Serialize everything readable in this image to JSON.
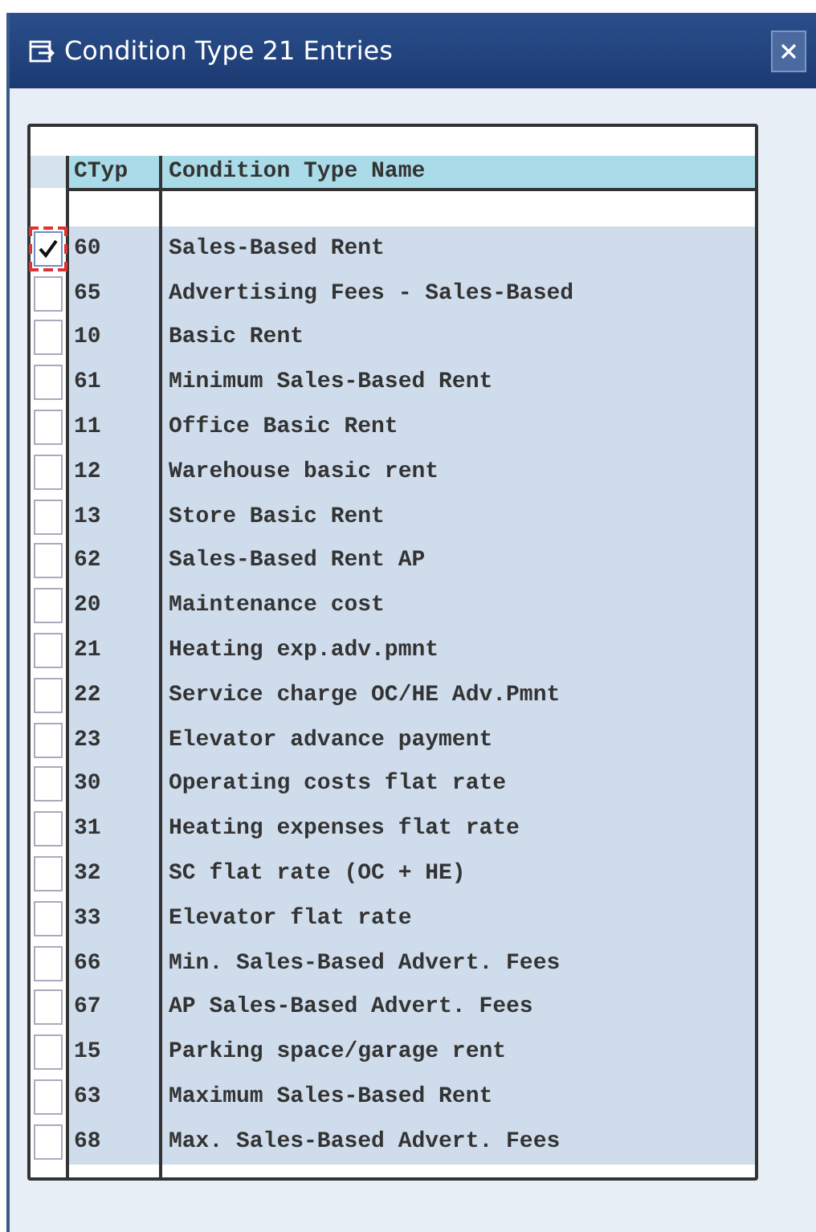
{
  "window": {
    "title": "Condition Type 21 Entries"
  },
  "table": {
    "columns": [
      "CTyp",
      "Condition Type Name"
    ],
    "rows": [
      {
        "selected": true,
        "ctyp": "60",
        "name": "Sales-Based Rent"
      },
      {
        "selected": false,
        "ctyp": "65",
        "name": "Advertising Fees - Sales-Based"
      },
      {
        "selected": false,
        "ctyp": "10",
        "name": "Basic Rent"
      },
      {
        "selected": false,
        "ctyp": "61",
        "name": "Minimum Sales-Based Rent"
      },
      {
        "selected": false,
        "ctyp": "11",
        "name": "Office Basic Rent"
      },
      {
        "selected": false,
        "ctyp": "12",
        "name": "Warehouse basic rent"
      },
      {
        "selected": false,
        "ctyp": "13",
        "name": "Store Basic Rent"
      },
      {
        "selected": false,
        "ctyp": "62",
        "name": "Sales-Based Rent AP"
      },
      {
        "selected": false,
        "ctyp": "20",
        "name": "Maintenance cost"
      },
      {
        "selected": false,
        "ctyp": "21",
        "name": "Heating exp.adv.pmnt"
      },
      {
        "selected": false,
        "ctyp": "22",
        "name": "Service charge OC/HE Adv.Pmnt"
      },
      {
        "selected": false,
        "ctyp": "23",
        "name": "Elevator advance payment"
      },
      {
        "selected": false,
        "ctyp": "30",
        "name": "Operating costs flat rate"
      },
      {
        "selected": false,
        "ctyp": "31",
        "name": "Heating expenses flat rate"
      },
      {
        "selected": false,
        "ctyp": "32",
        "name": "SC flat rate (OC + HE)"
      },
      {
        "selected": false,
        "ctyp": "33",
        "name": "Elevator flat rate"
      },
      {
        "selected": false,
        "ctyp": "66",
        "name": "Min. Sales-Based Advert. Fees"
      },
      {
        "selected": false,
        "ctyp": "67",
        "name": "AP Sales-Based Advert. Fees"
      },
      {
        "selected": false,
        "ctyp": "15",
        "name": "Parking space/garage rent"
      },
      {
        "selected": false,
        "ctyp": "63",
        "name": "Maximum Sales-Based Rent"
      },
      {
        "selected": false,
        "ctyp": "68",
        "name": "Max. Sales-Based Advert. Fees"
      }
    ]
  }
}
